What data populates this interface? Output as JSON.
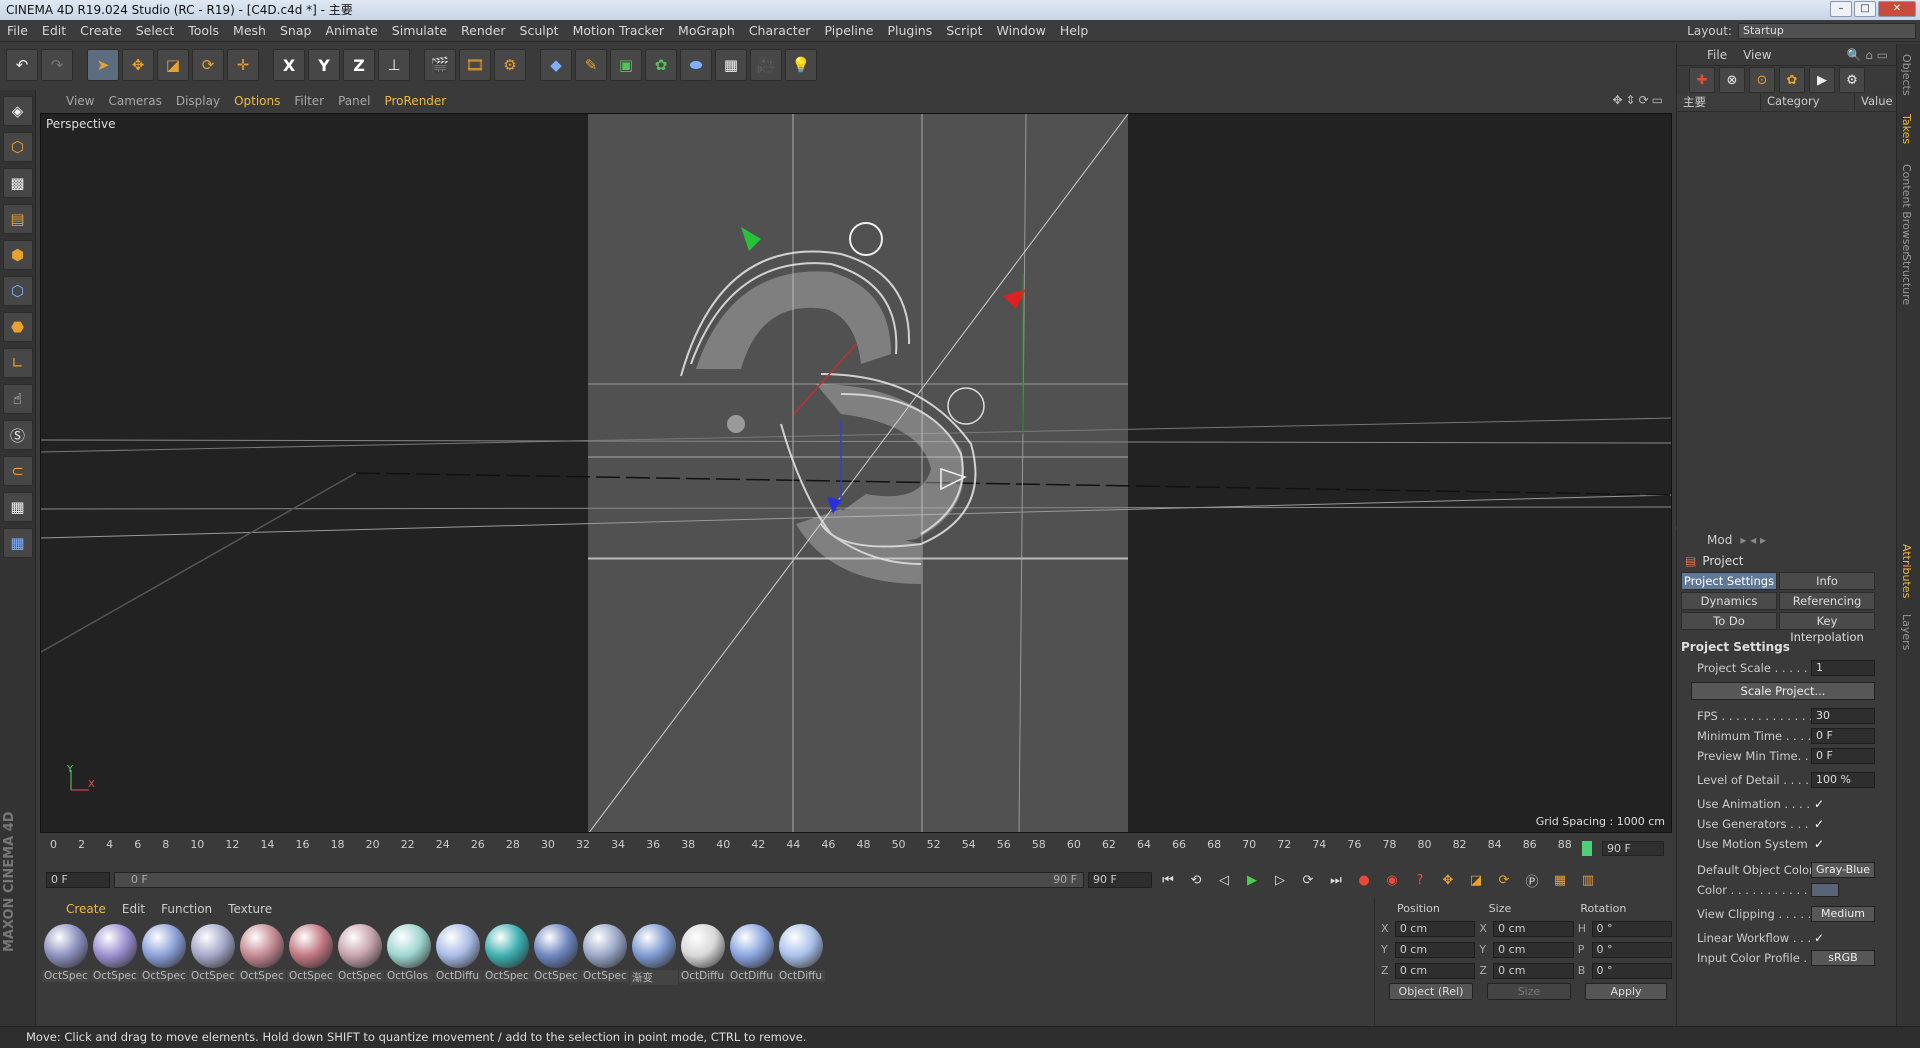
{
  "window": {
    "title": "CINEMA 4D R19.024 Studio (RC - R19) - [C4D.c4d *] - 主要"
  },
  "menu": [
    "File",
    "Edit",
    "Create",
    "Select",
    "Tools",
    "Mesh",
    "Snap",
    "Animate",
    "Simulate",
    "Render",
    "Sculpt",
    "Motion Tracker",
    "MoGraph",
    "Character",
    "Pipeline",
    "Plugins",
    "Script",
    "Window",
    "Help"
  ],
  "layout": {
    "label": "Layout:",
    "value": "Startup"
  },
  "viewport": {
    "menu": [
      "View",
      "Cameras",
      "Display",
      "Options",
      "Filter",
      "Panel",
      "ProRender"
    ],
    "label": "Perspective",
    "grid_spacing": "Grid Spacing : 1000 cm",
    "axis_y": "Y",
    "axis_x": "X"
  },
  "timeline": {
    "ticks": [
      "0",
      "2",
      "4",
      "6",
      "8",
      "10",
      "12",
      "14",
      "16",
      "18",
      "20",
      "22",
      "24",
      "26",
      "28",
      "30",
      "32",
      "34",
      "36",
      "38",
      "40",
      "42",
      "44",
      "46",
      "48",
      "50",
      "52",
      "54",
      "56",
      "58",
      "60",
      "62",
      "64",
      "66",
      "68",
      "70",
      "72",
      "74",
      "76",
      "78",
      "80",
      "82",
      "84",
      "86",
      "88"
    ],
    "end_frame": "90 F",
    "current": "0 F",
    "slider_start": "0 F",
    "slider_end": "90 F",
    "max": "90 F"
  },
  "materials": {
    "menu": [
      "Create",
      "Edit",
      "Function",
      "Texture"
    ],
    "items": [
      {
        "name": "OctSpec",
        "color": "#8d92c0"
      },
      {
        "name": "OctSpec",
        "color": "#9b8fd0"
      },
      {
        "name": "OctSpec",
        "color": "#8aa0d8"
      },
      {
        "name": "OctSpec",
        "color": "#a5a8c8"
      },
      {
        "name": "OctSpec",
        "color": "#c48a92"
      },
      {
        "name": "OctSpec",
        "color": "#c27883"
      },
      {
        "name": "OctSpec",
        "color": "#c6a3ad"
      },
      {
        "name": "OctGlos",
        "color": "#9fd6d0"
      },
      {
        "name": "OctDiffu",
        "color": "#a9bbe6"
      },
      {
        "name": "OctSpec",
        "color": "#3fb0b0"
      },
      {
        "name": "OctSpec",
        "color": "#6e87c0"
      },
      {
        "name": "OctSpec",
        "color": "#9aa8c8"
      },
      {
        "name": "渐变",
        "color": "#7e9ad0"
      },
      {
        "name": "OctDiffu",
        "color": "#d8d8d8"
      },
      {
        "name": "OctDiffu",
        "color": "#8aa6e0"
      },
      {
        "name": "OctDiffu",
        "color": "#aac2ea"
      }
    ]
  },
  "coords": {
    "headers": [
      "Position",
      "Size",
      "Rotation"
    ],
    "rows": [
      {
        "a": "X",
        "av": "0 cm",
        "b": "X",
        "bv": "0 cm",
        "c": "H",
        "cv": "0 °"
      },
      {
        "a": "Y",
        "av": "0 cm",
        "b": "Y",
        "bv": "0 cm",
        "c": "P",
        "cv": "0 °"
      },
      {
        "a": "Z",
        "av": "0 cm",
        "b": "Z",
        "bv": "0 cm",
        "c": "B",
        "cv": "0 °"
      }
    ],
    "mode": "Object (Rel)",
    "size_mode": "Size",
    "apply": "Apply"
  },
  "objects": {
    "menu": [
      "File",
      "View"
    ],
    "col_name": "主要",
    "col_category": "Category",
    "col_value": "Value"
  },
  "attributes": {
    "menu": "Mod",
    "title": "Project",
    "tabs": [
      "Project Settings",
      "Info",
      "Dynamics",
      "Referencing",
      "To Do",
      "Key Interpolation"
    ],
    "section": "Project Settings",
    "props": [
      {
        "label": "Project Scale . . . . . .",
        "value": "1"
      },
      {
        "label": "FPS . . . . . . . . . . . . . .",
        "value": "30"
      },
      {
        "label": "Minimum Time . . . . .",
        "value": "0 F"
      },
      {
        "label": "Preview Min Time. . .",
        "value": "0 F"
      },
      {
        "label": "Level of Detail . . . . .",
        "value": "100 %"
      }
    ],
    "scale_btn": "Scale Project...",
    "checks": [
      {
        "label": "Use Animation . . . . .",
        "value": "✓"
      },
      {
        "label": "Use Generators . . . .",
        "value": "✓"
      },
      {
        "label": "Use Motion System",
        "value": "✓"
      }
    ],
    "default_color_label": "Default Object Color",
    "default_color_value": "Gray-Blue",
    "color_label": "Color . . . . . . . . . . . .",
    "clipping_label": "View Clipping . . . . . .",
    "clipping_value": "Medium",
    "linear_label": "Linear Workflow . . . .",
    "linear_value": "✓",
    "icp_label": "Input Color Profile . .",
    "icp_value": "sRGB"
  },
  "side_tabs": [
    "Objects",
    "Takes",
    "Content Browser",
    "Structure",
    "Attributes",
    "Layers"
  ],
  "status": "Move: Click and drag to move elements. Hold down SHIFT to quantize movement / add to the selection in point mode, CTRL to remove."
}
